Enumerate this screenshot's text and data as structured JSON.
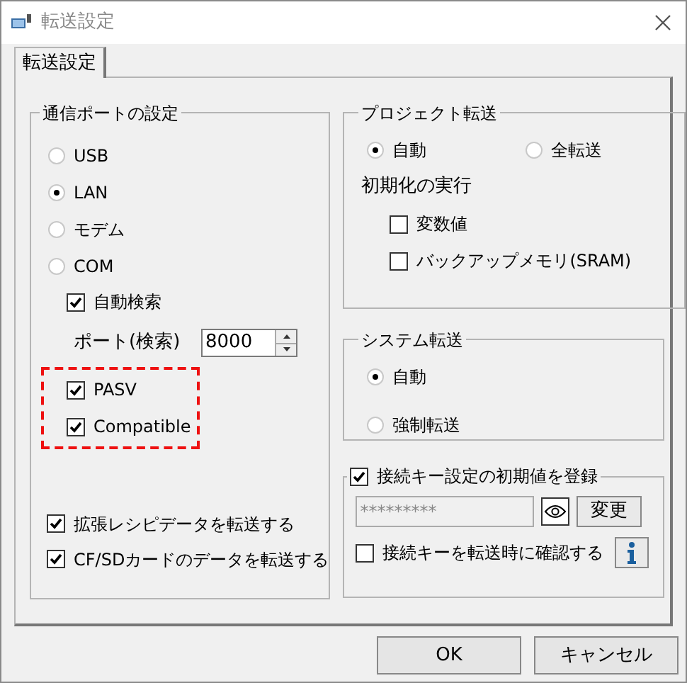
{
  "window": {
    "title": "転送設定"
  },
  "tabs": [
    {
      "label": "転送設定",
      "selected": true
    }
  ],
  "port_group": {
    "title": "通信ポートの設定",
    "options": [
      {
        "label": "USB",
        "selected": false
      },
      {
        "label": "LAN",
        "selected": true
      },
      {
        "label": "モデム",
        "selected": false
      },
      {
        "label": "COM",
        "selected": false
      }
    ],
    "auto_search": {
      "label": "自動検索",
      "checked": true
    },
    "port": {
      "label": "ポート(検索)",
      "value": "8000"
    },
    "highlighted_options": [
      {
        "label": "PASV",
        "checked": true
      },
      {
        "label": "Compatible",
        "checked": true
      }
    ]
  },
  "transfer_options": [
    {
      "label": "拡張レシピデータを転送する",
      "checked": true
    },
    {
      "label": "CF/SDカードのデータを転送する",
      "checked": true
    }
  ],
  "project_group": {
    "title": "プロジェクト転送",
    "options": [
      {
        "label": "自動",
        "selected": true
      },
      {
        "label": "全転送",
        "selected": false
      }
    ],
    "init_label": "初期化の実行",
    "init_options": [
      {
        "label": "変数値",
        "checked": false
      },
      {
        "label": "バックアップメモリ(SRAM)",
        "checked": false
      }
    ]
  },
  "system_group": {
    "title": "システム転送",
    "options": [
      {
        "label": "自動",
        "selected": true
      },
      {
        "label": "強制転送",
        "selected": false
      }
    ]
  },
  "key_group": {
    "title": "接続キー設定の初期値を登録",
    "checked": true,
    "key_value": "*********",
    "change_button": "変更",
    "confirm": {
      "label": "接続キーを転送時に確認する",
      "checked": false
    }
  },
  "buttons": [
    "OK",
    "キャンセル"
  ]
}
